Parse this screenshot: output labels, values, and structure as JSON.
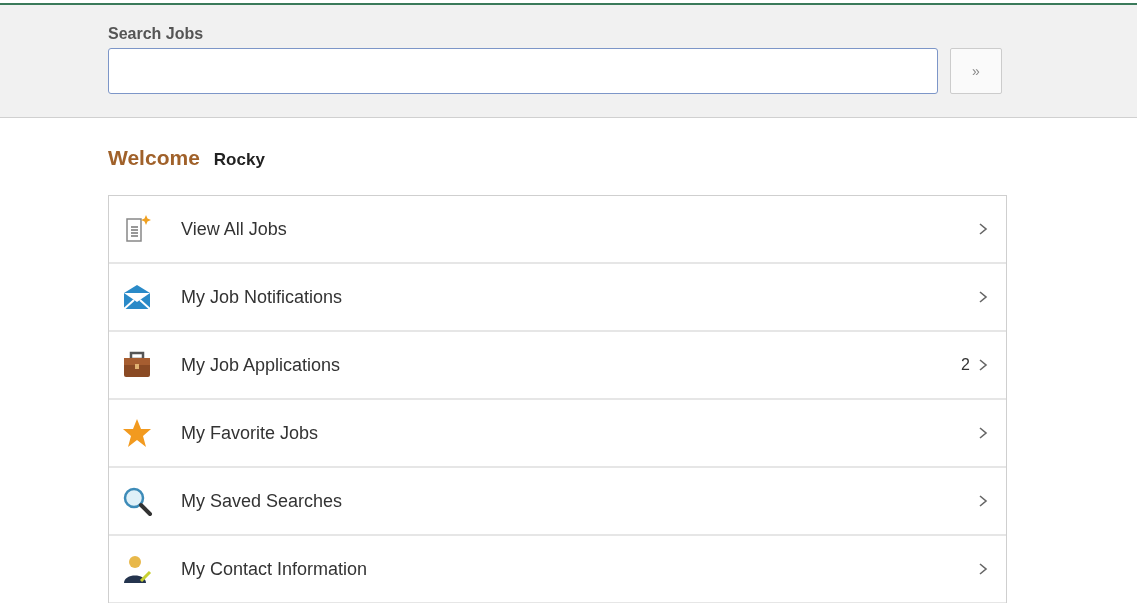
{
  "search": {
    "label": "Search Jobs",
    "button": "»"
  },
  "welcome": {
    "greeting": "Welcome",
    "name": "Rocky"
  },
  "menu": [
    {
      "label": "View All Jobs"
    },
    {
      "label": "My Job Notifications"
    },
    {
      "label": "My Job Applications",
      "count": "2"
    },
    {
      "label": "My Favorite Jobs"
    },
    {
      "label": "My Saved Searches"
    },
    {
      "label": "My Contact Information"
    }
  ]
}
